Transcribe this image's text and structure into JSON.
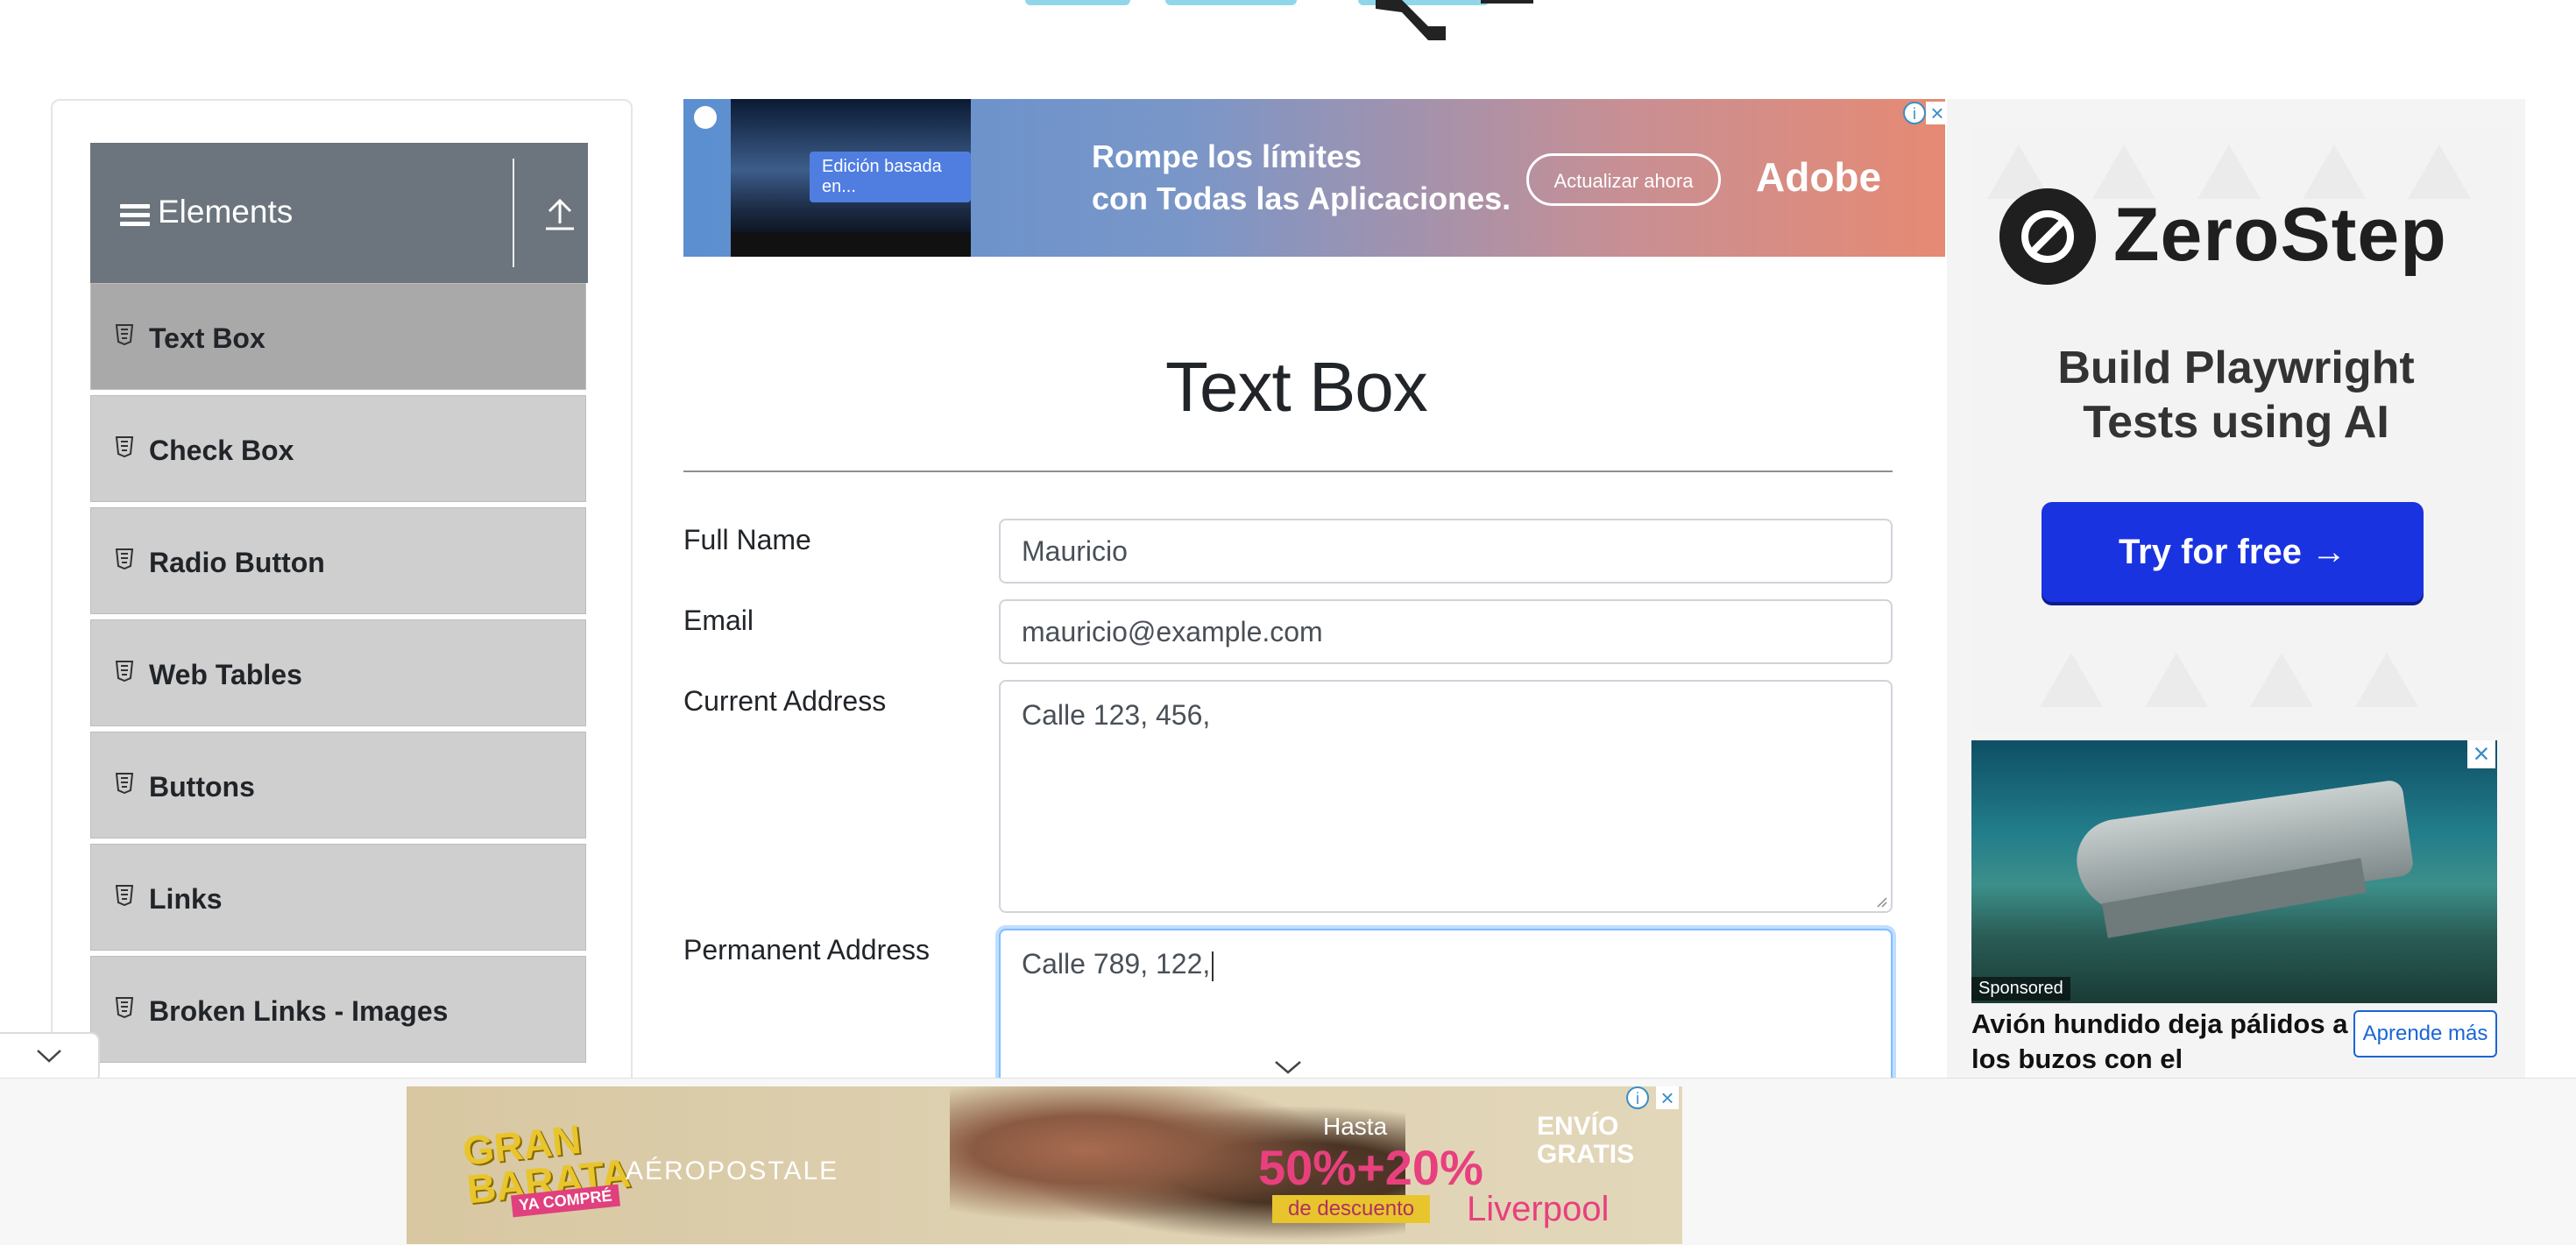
{
  "sidebar": {
    "group_title": "Elements",
    "items": [
      {
        "label": "Text Box",
        "active": true
      },
      {
        "label": "Check Box"
      },
      {
        "label": "Radio Button"
      },
      {
        "label": "Web Tables"
      },
      {
        "label": "Buttons"
      },
      {
        "label": "Links"
      },
      {
        "label": "Broken Links - Images"
      }
    ]
  },
  "main": {
    "title": "Text Box",
    "fields": {
      "full_name": {
        "label": "Full Name",
        "value": "Mauricio"
      },
      "email": {
        "label": "Email",
        "value": "mauricio@example.com"
      },
      "current_address": {
        "label": "Current Address",
        "value": "Calle 123, 456,"
      },
      "permanent_address": {
        "label": "Permanent Address",
        "value": "Calle 789, 122,"
      }
    }
  },
  "ads": {
    "top_banner": {
      "thumb_label": "Edición basada en...",
      "headline_line1": "Rompe los límites",
      "headline_line2": "con Todas las Aplicaciones.",
      "cta": "Actualizar ahora",
      "brand": "Adobe"
    },
    "right_zerostep": {
      "brand": "ZeroStep",
      "tagline_line1": "Build Playwright",
      "tagline_line2": "Tests using AI",
      "cta": "Try for free →",
      "accent": "#1a33e0"
    },
    "right_sponsored": {
      "badge": "Sponsored",
      "headline": "Avión hundido deja pálidos a los buzos con el",
      "cta": "Aprende más"
    },
    "bottom_banner": {
      "gran": "GRAN",
      "barata": "BARATA",
      "ya_compre": "YA COMPRÉ",
      "brand": "AÉROPOSTALE",
      "hasta": "Hasta",
      "discount": "50%+20%",
      "descuento": "de descuento",
      "envio": "ENVÍO",
      "gratis": "GRATIS",
      "store": "Liverpool"
    }
  }
}
